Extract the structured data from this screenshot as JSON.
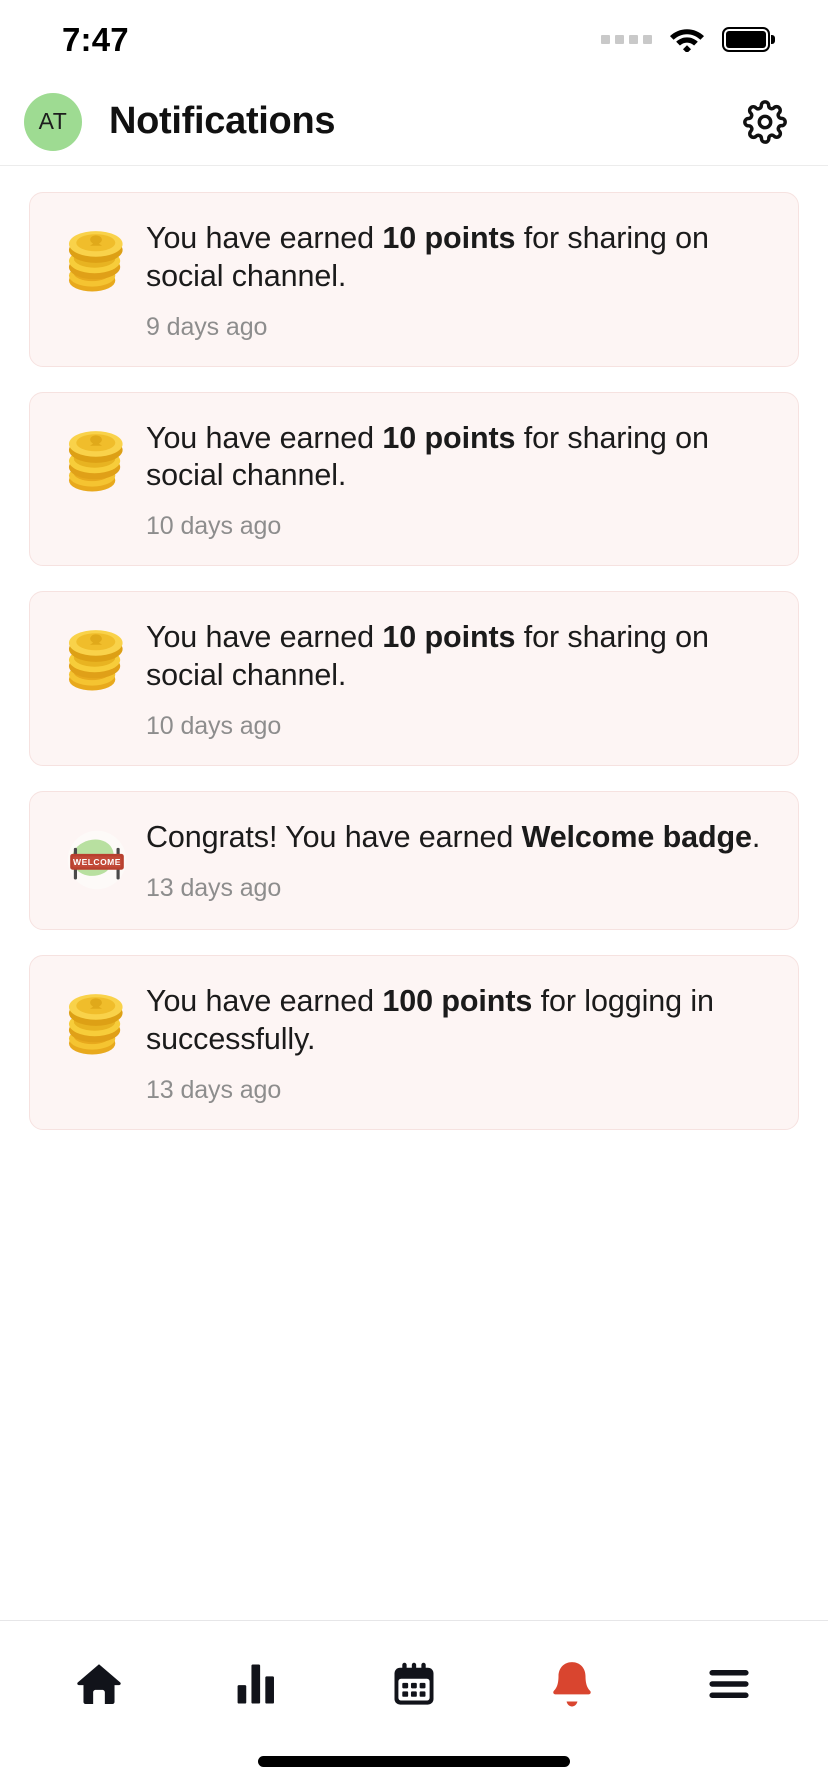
{
  "status_bar": {
    "time": "7:47",
    "signal_icon": "signal-dots-icon",
    "wifi_icon": "wifi-icon",
    "battery_icon": "battery-full-icon",
    "signal_dots": 4
  },
  "header": {
    "avatar_initials": "AT",
    "avatar_color": "#9edb92",
    "title": "Notifications",
    "settings_icon": "gear-icon"
  },
  "notifications": [
    {
      "icon": "coins-icon",
      "text_before": "You have earned ",
      "highlight": "10 points",
      "text_after": " for sharing on social channel.",
      "time": "9 days ago"
    },
    {
      "icon": "coins-icon",
      "text_before": "You have earned ",
      "highlight": "10 points",
      "text_after": " for sharing on social channel.",
      "time": "10 days ago"
    },
    {
      "icon": "coins-icon",
      "text_before": "You have earned ",
      "highlight": "10 points",
      "text_after": " for sharing on social channel.",
      "time": "10 days ago"
    },
    {
      "icon": "welcome-badge-icon",
      "text_before": "Congrats! You have earned ",
      "highlight": "Welcome badge",
      "text_after": ".",
      "time": "13 days ago",
      "badge_label": "WELCOME"
    },
    {
      "icon": "coins-icon",
      "text_before": "You have earned ",
      "highlight": "100 points",
      "text_after": " for logging in successfully.",
      "time": "13 days ago"
    }
  ],
  "bottom_nav": {
    "items": [
      {
        "icon": "home-icon",
        "active": false
      },
      {
        "icon": "bar-chart-icon",
        "active": false
      },
      {
        "icon": "calendar-icon",
        "active": false
      },
      {
        "icon": "bell-icon",
        "active": true
      },
      {
        "icon": "hamburger-menu-icon",
        "active": false
      }
    ],
    "active_color": "#d9452f",
    "inactive_color": "#11131a"
  },
  "colors": {
    "card_background": "#fdf5f4",
    "card_border": "#f6e2e0",
    "timestamp": "#8d8d8d",
    "page_background": "#ffffff"
  }
}
